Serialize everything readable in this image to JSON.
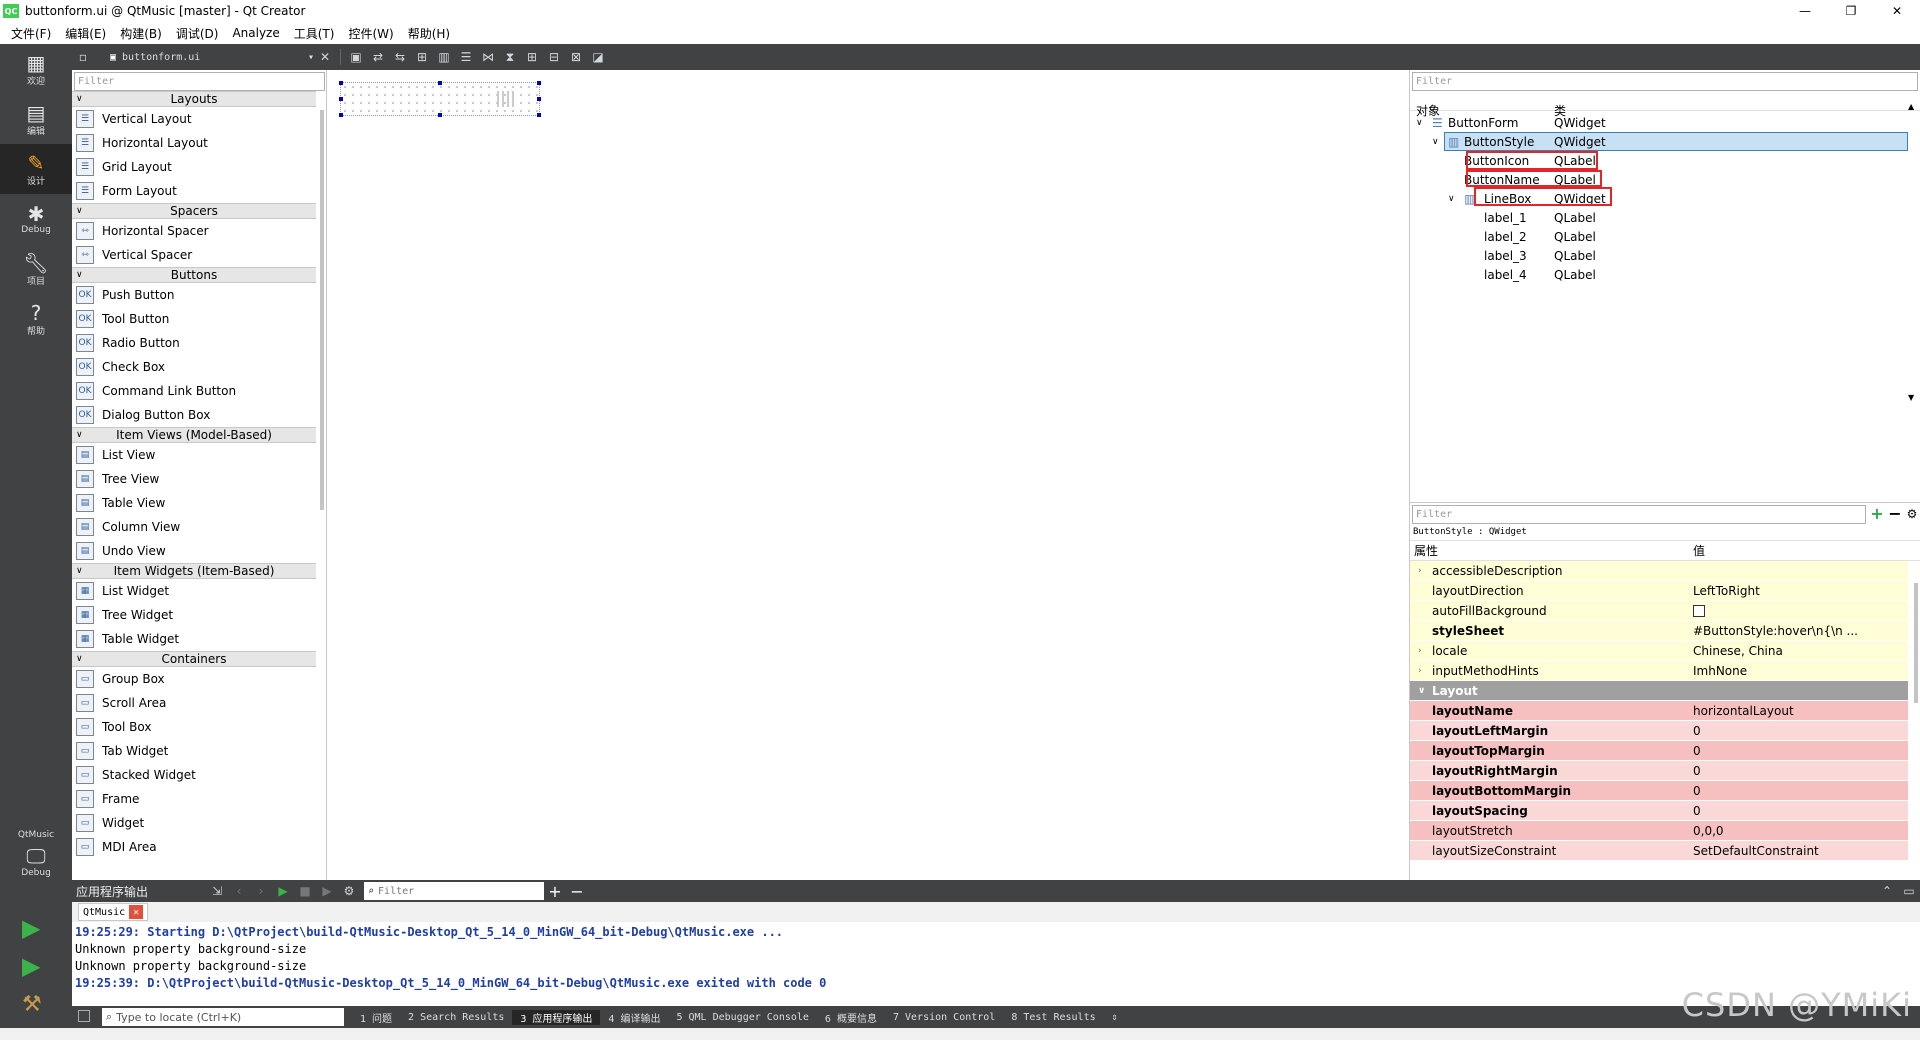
{
  "window": {
    "title": "buttonform.ui @ QtMusic [master] - Qt Creator",
    "app_icon": "QC",
    "controls": [
      "—",
      "❐",
      "✕"
    ]
  },
  "menu": [
    "文件(F)",
    "编辑(E)",
    "构建(B)",
    "调试(D)",
    "Analyze",
    "工具(T)",
    "控件(W)",
    "帮助(H)"
  ],
  "modes": [
    {
      "label": "欢迎",
      "icon": "grid-icon"
    },
    {
      "label": "编辑",
      "icon": "document-icon"
    },
    {
      "label": "设计",
      "icon": "pencil-icon"
    },
    {
      "label": "Debug",
      "icon": "bug-icon"
    },
    {
      "label": "项目",
      "icon": "wrench-icon"
    },
    {
      "label": "帮助",
      "icon": "help-icon"
    }
  ],
  "kit": {
    "project": "QtMusic",
    "mode": "Debug"
  },
  "toolbar": {
    "document": "buttonform.ui"
  },
  "widget_box": {
    "filter_placeholder": "Filter",
    "categories": [
      {
        "name": "Layouts",
        "items": [
          "Vertical Layout",
          "Horizontal Layout",
          "Grid Layout",
          "Form Layout"
        ]
      },
      {
        "name": "Spacers",
        "items": [
          "Horizontal Spacer",
          "Vertical Spacer"
        ]
      },
      {
        "name": "Buttons",
        "items": [
          "Push Button",
          "Tool Button",
          "Radio Button",
          "Check Box",
          "Command Link Button",
          "Dialog Button Box"
        ]
      },
      {
        "name": "Item Views (Model-Based)",
        "items": [
          "List View",
          "Tree View",
          "Table View",
          "Column View",
          "Undo View"
        ]
      },
      {
        "name": "Item Widgets (Item-Based)",
        "items": [
          "List Widget",
          "Tree Widget",
          "Table Widget"
        ]
      },
      {
        "name": "Containers",
        "items": [
          "Group Box",
          "Scroll Area",
          "Tool Box",
          "Tab Widget",
          "Stacked Widget",
          "Frame",
          "Widget",
          "MDI Area"
        ]
      }
    ]
  },
  "object_inspector": {
    "filter_placeholder": "Filter",
    "col_object": "对象",
    "col_class": "类",
    "rows": [
      {
        "name": "ButtonForm",
        "cls": "QWidget"
      },
      {
        "name": "ButtonStyle",
        "cls": "QWidget"
      },
      {
        "name": "ButtonIcon",
        "cls": "QLabel"
      },
      {
        "name": "ButtonName",
        "cls": "QLabel"
      },
      {
        "name": "LineBox",
        "cls": "QWidget"
      },
      {
        "name": "label_1",
        "cls": "QLabel"
      },
      {
        "name": "label_2",
        "cls": "QLabel"
      },
      {
        "name": "label_3",
        "cls": "QLabel"
      },
      {
        "name": "label_4",
        "cls": "QLabel"
      }
    ]
  },
  "property_editor": {
    "filter_placeholder": "Filter",
    "subtitle": "ButtonStyle : QWidget",
    "col_property": "属性",
    "col_value": "值",
    "rows": [
      {
        "name": "accessibleDescription",
        "value": ""
      },
      {
        "name": "layoutDirection",
        "value": "LeftToRight"
      },
      {
        "name": "autoFillBackground",
        "value": ""
      },
      {
        "name": "styleSheet",
        "value": "#ButtonStyle:hover\\n{\\n ..."
      },
      {
        "name": "locale",
        "value": "Chinese, China"
      },
      {
        "name": "inputMethodHints",
        "value": "ImhNone"
      },
      {
        "name": "Layout",
        "value": ""
      },
      {
        "name": "layoutName",
        "value": "horizontalLayout"
      },
      {
        "name": "layoutLeftMargin",
        "value": "0"
      },
      {
        "name": "layoutTopMargin",
        "value": "0"
      },
      {
        "name": "layoutRightMargin",
        "value": "0"
      },
      {
        "name": "layoutBottomMargin",
        "value": "0"
      },
      {
        "name": "layoutSpacing",
        "value": "0"
      },
      {
        "name": "layoutStretch",
        "value": "0,0,0"
      },
      {
        "name": "layoutSizeConstraint",
        "value": "SetDefaultConstraint"
      }
    ]
  },
  "output": {
    "pane_title": "应用程序输出",
    "filter_placeholder": "Filter",
    "tab": "QtMusic",
    "lines": [
      "19:25:29: Starting D:\\QtProject\\build-QtMusic-Desktop_Qt_5_14_0_MinGW_64_bit-Debug\\QtMusic.exe ...",
      "Unknown property background-size",
      "Unknown property background-size",
      "19:25:39: D:\\QtProject\\build-QtMusic-Desktop_Qt_5_14_0_MinGW_64_bit-Debug\\QtMusic.exe exited with code 0"
    ]
  },
  "statusbar": {
    "locate_placeholder": "Type to locate (Ctrl+K)",
    "tabs": [
      "1 问题",
      "2 Search Results",
      "3 应用程序输出",
      "4 编译输出",
      "5 QML Debugger Console",
      "6 概要信息",
      "7 Version Control",
      "8 Test Results"
    ]
  },
  "watermark": "CSDN @YMiKi",
  "colors": {
    "dark": "#404244",
    "selection": "#c7e0f4",
    "highlight_red": "#e3262a",
    "prop_yellow": "#fffdd5",
    "prop_pink": "#f7c0c0"
  }
}
